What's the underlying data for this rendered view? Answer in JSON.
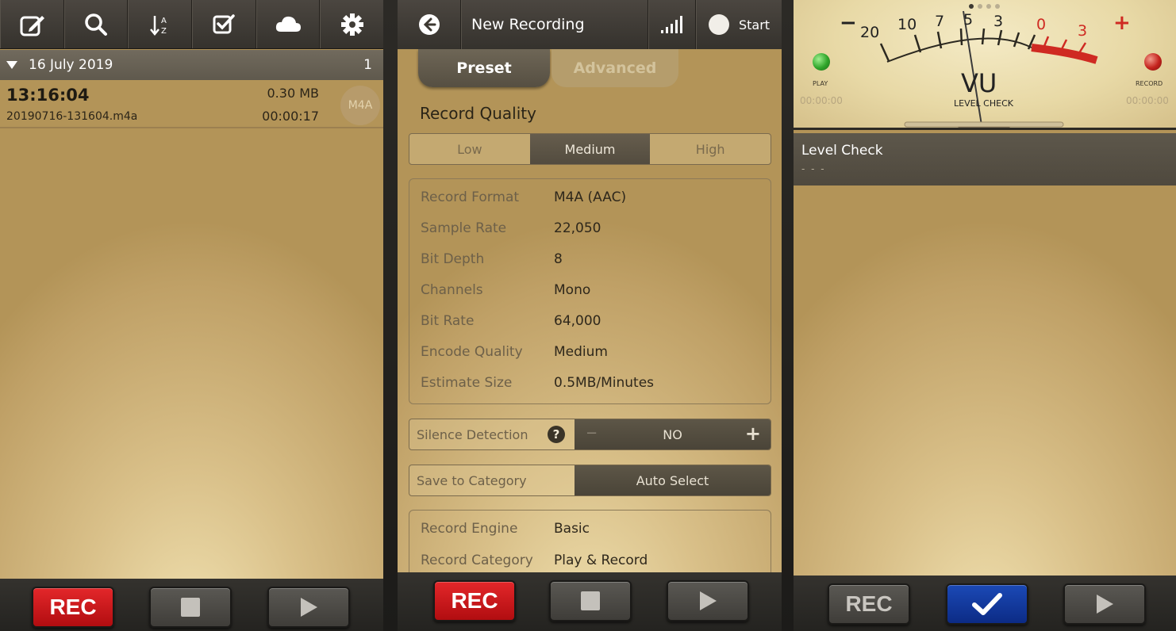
{
  "left_panel": {
    "toolbar": {
      "icons": [
        "edit-icon",
        "search-icon",
        "sort-az-icon",
        "select-check-icon",
        "cloud-icon",
        "gear-icon"
      ]
    },
    "date_group": {
      "date": "16 July 2019",
      "count": "1"
    },
    "recordings": [
      {
        "time": "13:16:04",
        "filename": "20190716-131604.m4a",
        "size": "0.30 MB",
        "duration": "00:00:17",
        "format": "M4A"
      }
    ],
    "bottom": {
      "rec_label": "REC"
    }
  },
  "middle_panel": {
    "nav": {
      "title": "New Recording",
      "start_label": "Start"
    },
    "tabs": {
      "preset": "Preset",
      "advanced": "Advanced"
    },
    "section_title": "Record Quality",
    "quality_options": [
      "Low",
      "Medium",
      "High"
    ],
    "quality_selected": "Medium",
    "format_info": [
      {
        "label": "Record Format",
        "value": "M4A (AAC)"
      },
      {
        "label": "Sample Rate",
        "value": "22,050"
      },
      {
        "label": "Bit Depth",
        "value": "8"
      },
      {
        "label": "Channels",
        "value": "Mono"
      },
      {
        "label": "Bit Rate",
        "value": "64,000"
      },
      {
        "label": "Encode Quality",
        "value": "Medium"
      },
      {
        "label": "Estimate Size",
        "value": "0.5MB/Minutes"
      }
    ],
    "silence_detection": {
      "label": "Silence Detection",
      "help": "?",
      "value": "NO",
      "minus": "−",
      "plus": "+"
    },
    "save_category": {
      "label": "Save to Category",
      "value": "Auto Select"
    },
    "engine_info": [
      {
        "label": "Record Engine",
        "value": "Basic"
      },
      {
        "label": "Record Category",
        "value": "Play & Record"
      }
    ],
    "bottom": {
      "rec_label": "REC"
    }
  },
  "right_panel": {
    "vu_meter": {
      "scale": [
        "−",
        "20",
        "10",
        "7",
        "5",
        "3",
        "0",
        "3",
        "+"
      ],
      "title": "VU",
      "subtitle": "LEVEL CHECK",
      "play_label": "PLAY",
      "record_label": "RECORD",
      "play_time": "00:00:00",
      "record_time": "00:00:00",
      "play_led_color": "#2fa52a",
      "record_led_color": "#c4221c",
      "needle_level_db": -5
    },
    "level_check": {
      "title": "Level Check",
      "subtitle": "- - -"
    },
    "bottom": {
      "rec_label": "REC"
    }
  },
  "colors": {
    "rec_red": "#c8181b",
    "confirm_blue": "#123a9e",
    "panel_dark": "#4b4640"
  }
}
